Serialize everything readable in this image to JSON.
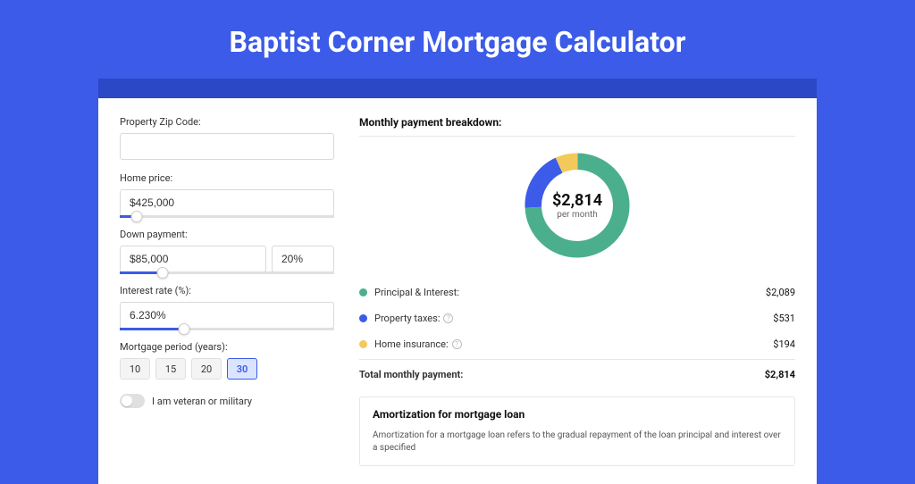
{
  "title": "Baptist Corner Mortgage Calculator",
  "form": {
    "zip_label": "Property Zip Code:",
    "zip_value": "",
    "home_price_label": "Home price:",
    "home_price_value": "$425,000",
    "home_price_pct": 8,
    "down_payment_label": "Down payment:",
    "down_payment_value": "$85,000",
    "down_payment_pct_value": "20%",
    "down_payment_slider_pct": 20,
    "interest_label": "Interest rate (%):",
    "interest_value": "6.230%",
    "interest_slider_pct": 30,
    "period_label": "Mortgage period (years):",
    "periods": [
      "10",
      "15",
      "20",
      "30"
    ],
    "period_active": "30",
    "veteran_label": "I am veteran or military"
  },
  "breakdown": {
    "heading": "Monthly payment breakdown:",
    "center_value": "$2,814",
    "center_sub": "per month",
    "items": [
      {
        "label": "Principal & Interest:",
        "amount": "$2,089",
        "color": "green",
        "info": false
      },
      {
        "label": "Property taxes:",
        "amount": "$531",
        "color": "blue",
        "info": true
      },
      {
        "label": "Home insurance:",
        "amount": "$194",
        "color": "yellow",
        "info": true
      }
    ],
    "total_label": "Total monthly payment:",
    "total_amount": "$2,814"
  },
  "amort": {
    "title": "Amortization for mortgage loan",
    "text": "Amortization for a mortgage loan refers to the gradual repayment of the loan principal and interest over a specified"
  },
  "chart_data": {
    "type": "pie",
    "title": "Monthly payment breakdown",
    "series": [
      {
        "name": "Principal & Interest",
        "value": 2089,
        "color": "#4BAF8E"
      },
      {
        "name": "Property taxes",
        "value": 531,
        "color": "#3B5BE8"
      },
      {
        "name": "Home insurance",
        "value": 194,
        "color": "#F3C95B"
      }
    ],
    "total": 2814,
    "center_label": "$2,814 per month"
  }
}
